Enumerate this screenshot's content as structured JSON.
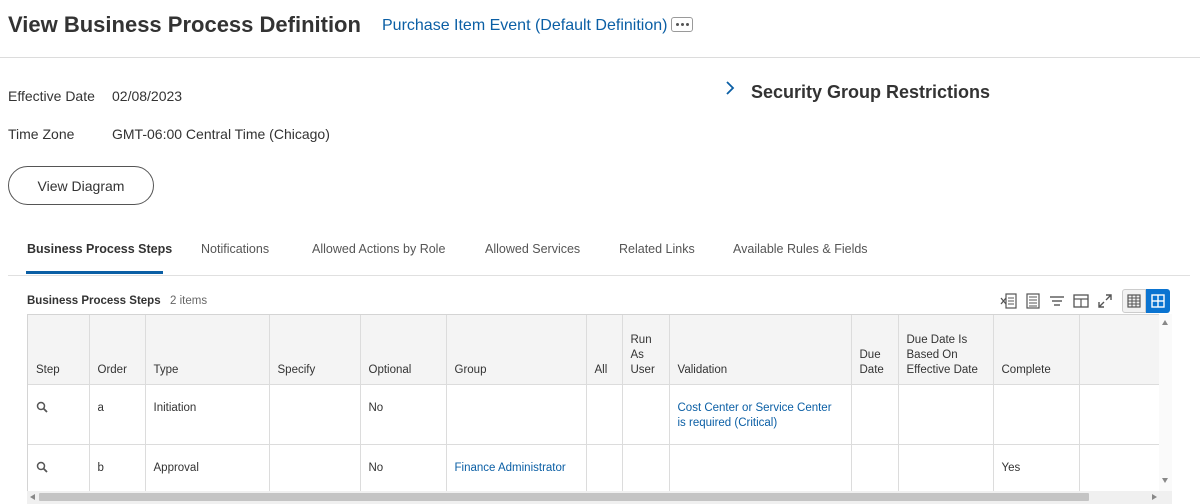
{
  "header": {
    "title": "View Business Process Definition",
    "subtitle": "Purchase Item Event (Default Definition)"
  },
  "fields": {
    "effective_date_label": "Effective Date",
    "effective_date_value": "02/08/2023",
    "time_zone_label": "Time Zone",
    "time_zone_value": "GMT-06:00 Central Time (Chicago)"
  },
  "view_diagram_label": "View Diagram",
  "security_section": {
    "title": "Security Group Restrictions"
  },
  "tabs": [
    {
      "label": "Business Process Steps",
      "active": true
    },
    {
      "label": "Notifications"
    },
    {
      "label": "Allowed Actions by Role"
    },
    {
      "label": "Allowed Services"
    },
    {
      "label": "Related Links"
    },
    {
      "label": "Available Rules & Fields"
    }
  ],
  "grid": {
    "title": "Business Process Steps",
    "count": "2 items",
    "columns": {
      "step": "Step",
      "order": "Order",
      "type": "Type",
      "specify": "Specify",
      "optional": "Optional",
      "group": "Group",
      "all": "All",
      "run_as_user": [
        "Run",
        "As",
        "User"
      ],
      "validation": "Validation",
      "due_date": [
        "Due",
        "Date"
      ],
      "due_date_based": [
        "Due Date Is",
        "Based On",
        "Effective Date"
      ],
      "complete": "Complete"
    },
    "rows": [
      {
        "order": "a",
        "type": "Initiation",
        "specify": "",
        "optional": "No",
        "group": "",
        "all": "",
        "run_as_user": "",
        "validation": "Cost Center or Service Center is required (Critical)",
        "due_date": "",
        "due_date_based": "",
        "complete": ""
      },
      {
        "order": "b",
        "type": "Approval",
        "specify": "",
        "optional": "No",
        "group": "Finance Administrator",
        "all": "",
        "run_as_user": "",
        "validation": "",
        "due_date": "",
        "due_date_based": "",
        "complete": "Yes"
      }
    ]
  },
  "colors": {
    "link": "#0b5fa5",
    "accent": "#0b74d1",
    "text": "#333333"
  }
}
